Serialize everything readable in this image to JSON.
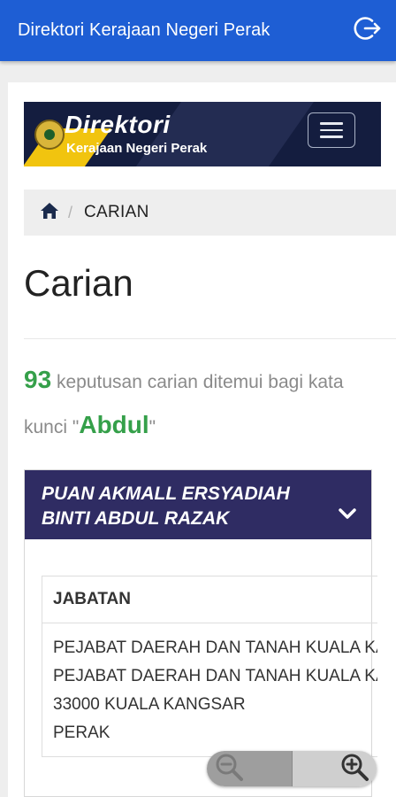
{
  "appbar": {
    "title": "Direktori Kerajaan Negeri Perak",
    "logout_icon": "logout-icon"
  },
  "site_header": {
    "brand_title": "Direktori",
    "brand_subtitle": "Kerajaan Negeri Perak",
    "menu_icon": "hamburger-icon"
  },
  "breadcrumb": {
    "home_icon": "home-icon",
    "separator": "/",
    "current": "CARIAN"
  },
  "page": {
    "title": "Carian"
  },
  "results": {
    "count": "93",
    "text_before": "keputusan carian ditemui bagi kata kunci",
    "quote_open": "\"",
    "keyword": "Abdul",
    "quote_close": "\""
  },
  "accordion": {
    "header": "PUAN AKMALL ERSYADIAH BINTI ABDUL RAZAK",
    "chevron_icon": "chevron-down-icon",
    "table": {
      "column_header": "JABATAN",
      "lines": [
        "PEJABAT DAERAH DAN TANAH KUALA KANGSAR",
        "PEJABAT DAERAH DAN TANAH KUALA KANGSAR",
        "33000 KUALA KANGSAR",
        "PERAK"
      ]
    }
  },
  "zoom": {
    "zoom_out_icon": "zoom-out-icon",
    "zoom_in_icon": "zoom-in-icon"
  },
  "colors": {
    "appbar": "#1e5ed4",
    "header_navy": "#141d3f",
    "accordion_header": "#2f2c63",
    "accent_green": "#35a04a",
    "accent_yellow": "#f1c40f"
  }
}
